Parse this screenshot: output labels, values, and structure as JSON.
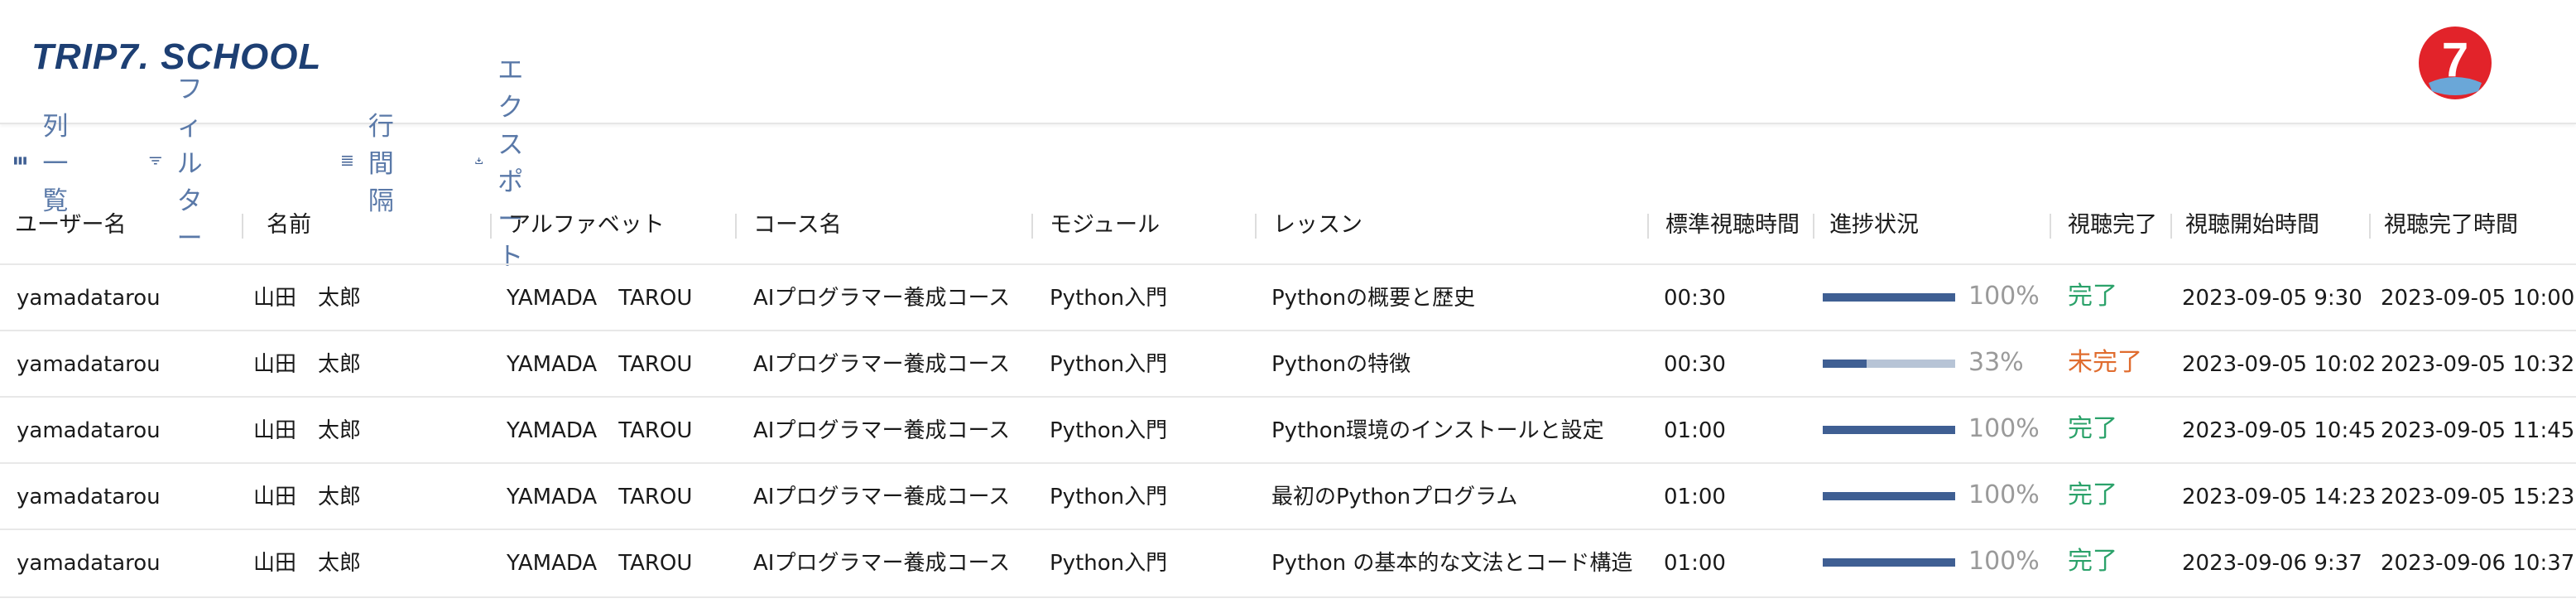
{
  "brand": {
    "logo_text": "TRIP7. SCHOOL",
    "badge_text": "7",
    "accent": "#1d3f73",
    "badge_color": "#e2232a"
  },
  "toolbar": {
    "columns_label": "列一覧",
    "filter_label": "フィルター",
    "density_label": "行間隔",
    "export_label": "エクスポート"
  },
  "table": {
    "headers": [
      "ユーザー名",
      "名前",
      "アルファベット",
      "コース名",
      "モジュール",
      "レッスン",
      "標準視聴時間",
      "進捗状況",
      "視聴完了",
      "視聴開始時間",
      "視聴完了時間"
    ],
    "rows": [
      {
        "user": "yamadatarou",
        "name": "山田　太郎",
        "alpha": "YAMADA　TAROU",
        "course": "AIプログラマー養成コース",
        "module": "Python入門",
        "lesson": "Pythonの概要と歴史",
        "duration": "00:30",
        "progress": 100,
        "progress_label": "100%",
        "status": "完了",
        "start": "2023-09-05 9:30",
        "end": "2023-09-05 10:00"
      },
      {
        "user": "yamadatarou",
        "name": "山田　太郎",
        "alpha": "YAMADA　TAROU",
        "course": "AIプログラマー養成コース",
        "module": "Python入門",
        "lesson": "Pythonの特徴",
        "duration": "00:30",
        "progress": 33,
        "progress_label": "33%",
        "status": "未完了",
        "start": "2023-09-05 10:02",
        "end": "2023-09-05 10:32"
      },
      {
        "user": "yamadatarou",
        "name": "山田　太郎",
        "alpha": "YAMADA　TAROU",
        "course": "AIプログラマー養成コース",
        "module": "Python入門",
        "lesson": "Python環境のインストールと設定",
        "duration": "01:00",
        "progress": 100,
        "progress_label": "100%",
        "status": "完了",
        "start": "2023-09-05 10:45",
        "end": "2023-09-05 11:45"
      },
      {
        "user": "yamadatarou",
        "name": "山田　太郎",
        "alpha": "YAMADA　TAROU",
        "course": "AIプログラマー養成コース",
        "module": "Python入門",
        "lesson": "最初のPythonプログラム",
        "duration": "01:00",
        "progress": 100,
        "progress_label": "100%",
        "status": "完了",
        "start": "2023-09-05 14:23",
        "end": "2023-09-05 15:23"
      },
      {
        "user": "yamadatarou",
        "name": "山田　太郎",
        "alpha": "YAMADA　TAROU",
        "course": "AIプログラマー養成コース",
        "module": "Python入門",
        "lesson": "Python の基本的な文法とコード構造",
        "duration": "01:00",
        "progress": 100,
        "progress_label": "100%",
        "status": "完了",
        "start": "2023-09-06 9:37",
        "end": "2023-09-06 10:37"
      }
    ]
  },
  "colors": {
    "done": "#2ba26a",
    "not_done": "#e06c2e",
    "progress_fill": "#3f5f93",
    "progress_track": "#b7c4d6"
  }
}
